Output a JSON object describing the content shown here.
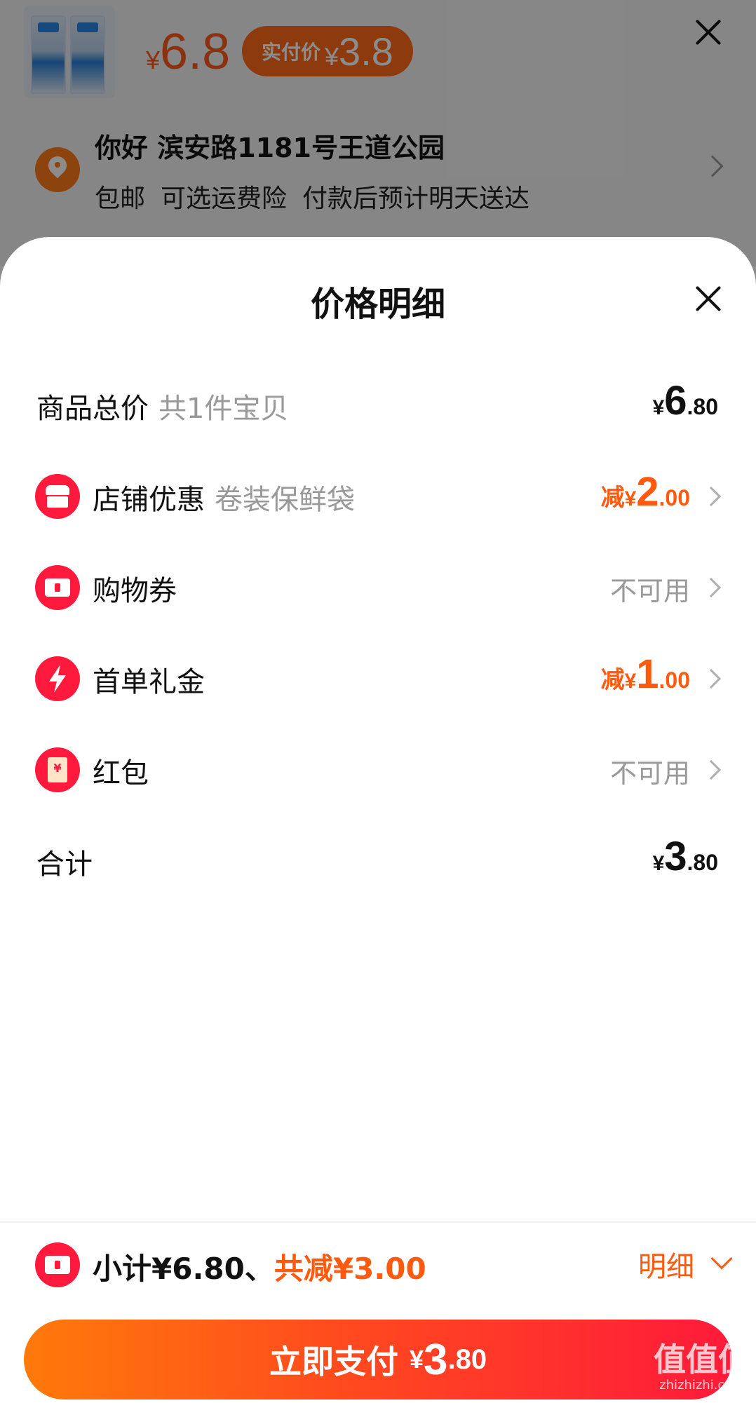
{
  "background": {
    "price_currency": "¥",
    "price": "6.8",
    "actual_label": "实付价",
    "actual_currency": "¥",
    "actual_price": "3.8",
    "address": "你好 滨安路1181号王道公园",
    "shipping": [
      "包邮",
      "可选运费险",
      "付款后预计明天送达"
    ]
  },
  "sheet": {
    "title": "价格明细",
    "rows": [
      {
        "label": "商品总价",
        "sub": "共1件宝贝",
        "currency": "¥",
        "int": "6",
        "dec": ".80"
      },
      {
        "label": "店铺优惠",
        "sub": "卷装保鲜袋",
        "prefix": "减",
        "currency": "¥",
        "int": "2",
        "dec": ".00",
        "icon": "shop-icon"
      },
      {
        "label": "购物券",
        "value": "不可用",
        "icon": "ticket-icon"
      },
      {
        "label": "首单礼金",
        "prefix": "减",
        "currency": "¥",
        "int": "1",
        "dec": ".00",
        "icon": "lightning-icon"
      },
      {
        "label": "红包",
        "value": "不可用",
        "icon": "red-envelope-icon"
      },
      {
        "label": "合计",
        "currency": "¥",
        "int": "3",
        "dec": ".80"
      }
    ]
  },
  "bottom": {
    "subtotal": "小计¥6.80、",
    "discount": "共减¥3.00",
    "detail_label": "明细",
    "pay_label": "立即支付",
    "pay_currency": "¥",
    "pay_int": "3",
    "pay_dec": ".80"
  },
  "watermark": {
    "big": "值值值",
    "small": "zhizhizhi.com"
  },
  "colors": {
    "accent": "#ff5a10",
    "brand_red": "#ff1a3d",
    "muted": "#999999"
  }
}
